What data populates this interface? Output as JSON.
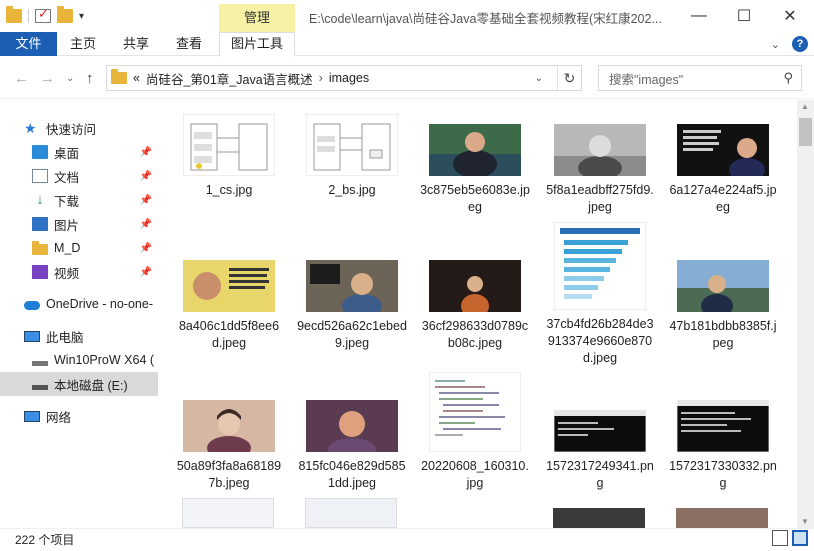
{
  "window": {
    "title": "E:\\code\\learn\\java\\尚硅谷Java零基础全套视频教程(宋红康202...",
    "context_tab": "管理",
    "min_glyph": "—",
    "max_glyph": "☐",
    "close_glyph": "✕"
  },
  "ribbon": {
    "tabs": [
      "文件",
      "主页",
      "共享",
      "查看",
      "图片工具"
    ]
  },
  "address": {
    "crumb_arrows": "«",
    "path": [
      "尚硅谷_第01章_Java语言概述",
      "images"
    ],
    "refresh_glyph": "↻",
    "search_placeholder": "搜索\"images\""
  },
  "nav": {
    "quick_access": "快速访问",
    "pinned": [
      "桌面",
      "文档",
      "下载",
      "图片",
      "M_D",
      "视频"
    ],
    "onedrive": "OneDrive - no-one-",
    "this_pc": "此电脑",
    "drives": [
      "Win10ProW X64 (",
      "本地磁盘 (E:)"
    ],
    "network": "网络"
  },
  "files": [
    "1_cs.jpg",
    "2_bs.jpg",
    "3c875eb5e6083e.jpeg",
    "5f8a1eadbff275fd9.jpeg",
    "6a127a4e224af5.jpeg",
    "8a406c1dd5f8ee6d.jpeg",
    "9ecd526a62c1ebed9.jpeg",
    "36cf298633d0789cb08c.jpeg",
    "37cb4fd26b284de3913374e9660e870d.jpeg",
    "47b181bdbb8385f.jpeg",
    "50a89f3fa8a681897b.jpeg",
    "815fc046e829d5851dd.jpeg",
    "20220608_160310.jpg",
    "1572317249341.png",
    "1572317330332.png"
  ],
  "status": {
    "count": "222 个项目"
  },
  "colors": {
    "accent": "#1a5fb4",
    "manage_tab": "#f7f1a6"
  }
}
